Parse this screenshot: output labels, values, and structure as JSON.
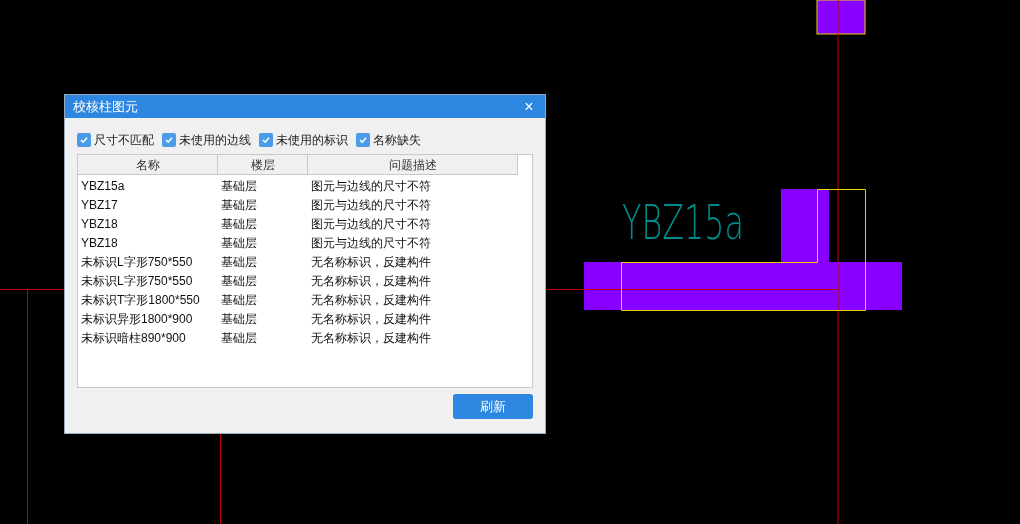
{
  "canvas": {
    "label": "YBZ15a"
  },
  "dialog": {
    "title": "校核柱图元",
    "close": "×",
    "filters": [
      {
        "label": "尺寸不匹配",
        "checked": true
      },
      {
        "label": "未使用的边线",
        "checked": true
      },
      {
        "label": "未使用的标识",
        "checked": true
      },
      {
        "label": "名称缺失",
        "checked": true
      }
    ],
    "table": {
      "columns": [
        "名称",
        "楼层",
        "问题描述"
      ],
      "rows": [
        [
          "YBZ15a",
          "基础层",
          "图元与边线的尺寸不符"
        ],
        [
          "YBZ17",
          "基础层",
          "图元与边线的尺寸不符"
        ],
        [
          "YBZ18",
          "基础层",
          "图元与边线的尺寸不符"
        ],
        [
          "YBZ18",
          "基础层",
          "图元与边线的尺寸不符"
        ],
        [
          "未标识L字形750*550",
          "基础层",
          "无名称标识，反建构件"
        ],
        [
          "未标识L字形750*550",
          "基础层",
          "无名称标识，反建构件"
        ],
        [
          "未标识T字形1800*550",
          "基础层",
          "无名称标识，反建构件"
        ],
        [
          "未标识异形1800*900",
          "基础层",
          "无名称标识，反建构件"
        ],
        [
          "未标识暗柱890*900",
          "基础层",
          "无名称标识，反建构件"
        ]
      ]
    },
    "buttons": [
      "刷新"
    ]
  }
}
